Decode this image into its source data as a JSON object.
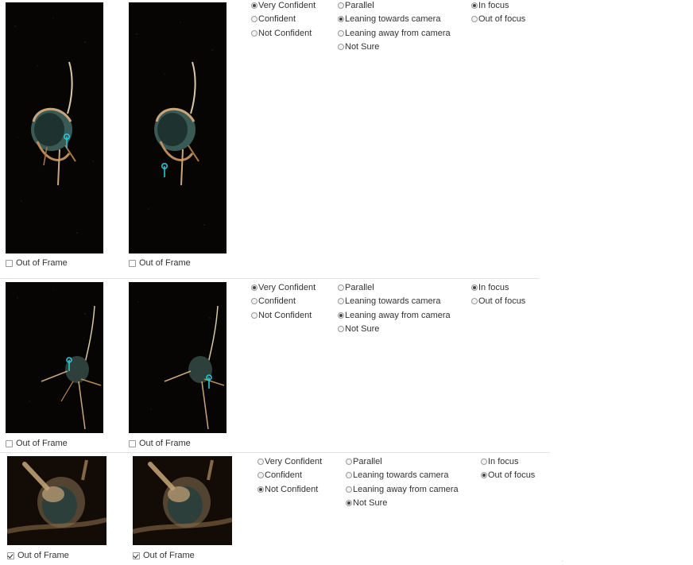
{
  "rows": [
    {
      "images": [
        {
          "name": "image-a",
          "out_of_frame_label": "Out of Frame",
          "out_of_frame_checked": false
        },
        {
          "name": "image-b",
          "out_of_frame_label": "Out of Frame",
          "out_of_frame_checked": false
        }
      ],
      "confidence": {
        "options": [
          "Very Confident",
          "Confident",
          "Not Confident"
        ],
        "selected": "Very Confident"
      },
      "orientation": {
        "options": [
          "Parallel",
          "Leaning towards camera",
          "Leaning away from camera",
          "Not Sure"
        ],
        "selected": "Leaning towards camera"
      },
      "focus": {
        "options": [
          "In focus",
          "Out of focus"
        ],
        "selected": "In focus"
      }
    },
    {
      "images": [
        {
          "name": "image-a",
          "out_of_frame_label": "Out of Frame",
          "out_of_frame_checked": false
        },
        {
          "name": "image-b",
          "out_of_frame_label": "Out of Frame",
          "out_of_frame_checked": false
        }
      ],
      "confidence": {
        "options": [
          "Very Confident",
          "Confident",
          "Not Confident"
        ],
        "selected": "Very Confident"
      },
      "orientation": {
        "options": [
          "Parallel",
          "Leaning towards camera",
          "Leaning away from camera",
          "Not Sure"
        ],
        "selected": "Leaning away from camera"
      },
      "focus": {
        "options": [
          "In focus",
          "Out of focus"
        ],
        "selected": "In focus"
      }
    },
    {
      "images": [
        {
          "name": "image-a",
          "out_of_frame_label": "Out of Frame",
          "out_of_frame_checked": true
        },
        {
          "name": "image-b",
          "out_of_frame_label": "Out of Frame",
          "out_of_frame_checked": true
        }
      ],
      "confidence": {
        "options": [
          "Very Confident",
          "Confident",
          "Not Confident"
        ],
        "selected": "Not Confident"
      },
      "orientation": {
        "options": [
          "Parallel",
          "Leaning towards camera",
          "Leaning away from camera",
          "Not Sure"
        ],
        "selected": "Not Sure"
      },
      "focus": {
        "options": [
          "In focus",
          "Out of focus"
        ],
        "selected": "Out of focus"
      }
    }
  ],
  "colors": {
    "marker": "#29c4d6",
    "image_background": "#070503",
    "divider": "#e2e2e2"
  }
}
